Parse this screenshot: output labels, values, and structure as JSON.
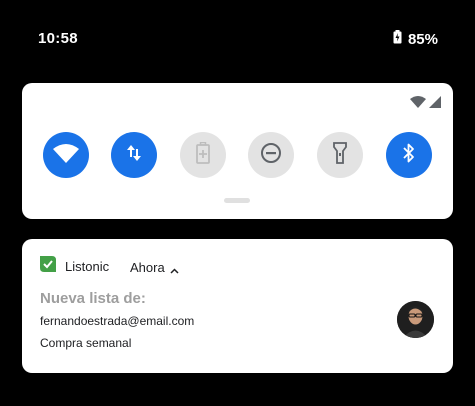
{
  "status_bar": {
    "time": "10:58",
    "battery_percent": "85%",
    "icons": [
      "battery-charging-icon"
    ]
  },
  "quick_settings": {
    "signal_icons": [
      "wifi-small-icon",
      "cell-signal-icon"
    ],
    "tiles": [
      {
        "name": "wifi",
        "icon": "wifi-icon",
        "active": true
      },
      {
        "name": "mobile-data",
        "icon": "data-arrows-icon",
        "active": true
      },
      {
        "name": "battery-saver",
        "icon": "battery-saver-icon",
        "active": false
      },
      {
        "name": "do-not-disturb",
        "icon": "dnd-icon",
        "active": false
      },
      {
        "name": "flashlight",
        "icon": "flashlight-icon",
        "active": false
      },
      {
        "name": "bluetooth",
        "icon": "bluetooth-icon",
        "active": true
      }
    ]
  },
  "notification": {
    "app_name": "Listonic",
    "app_icon": "listonic-icon",
    "time": "Ahora",
    "title": "Nueva lista de:",
    "line1": "fernandoestrada@email.com",
    "line2": "Compra semanal",
    "avatar_icon": "avatar"
  },
  "colors": {
    "accent": "#1a73e8",
    "inactive_tile": "#e3e3e3",
    "listonic_green": "#43a047"
  }
}
